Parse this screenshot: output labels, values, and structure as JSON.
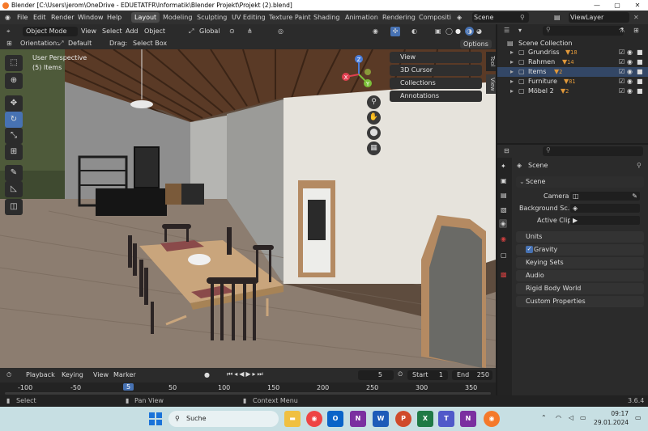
{
  "titlebar": {
    "title": "Blender [C:\\Users\\jerom\\OneDrive - EDUETATFR\\Informatik\\Blender Projekt\\Projekt (2).blend]"
  },
  "menu": {
    "file": "File",
    "edit": "Edit",
    "render": "Render",
    "window": "Window",
    "help": "Help"
  },
  "workspaces": [
    "Layout",
    "Modeling",
    "Sculpting",
    "UV Editing",
    "Texture Paint",
    "Shading",
    "Animation",
    "Rendering",
    "Compositi"
  ],
  "scene_name": "Scene",
  "view_layer": "ViewLayer",
  "header": {
    "mode": "Object Mode",
    "view": "View",
    "select": "Select",
    "add": "Add",
    "object": "Object",
    "transform": "Global"
  },
  "subheader": {
    "orientation_label": "Orientation:",
    "orientation_value": "Default",
    "drag_label": "Drag:",
    "drag_value": "Select Box",
    "options": "Options"
  },
  "viewport": {
    "perspective": "User Perspective",
    "selection": "(5) Items"
  },
  "npanel": [
    "View",
    "3D Cursor",
    "Collections",
    "Annotations"
  ],
  "vtabs": {
    "tool": "Tool",
    "view": "View"
  },
  "gizmo": {
    "x": "X",
    "y": "Y",
    "z": "Z"
  },
  "timeline": {
    "playback": "Playback",
    "keying": "Keying",
    "view": "View",
    "marker": "Marker",
    "current_frame": "5",
    "start_label": "Start",
    "start": "1",
    "end_label": "End",
    "end": "250",
    "ruler": [
      "-100",
      "-50",
      "5",
      "50",
      "100",
      "150",
      "200",
      "250",
      "300",
      "350"
    ]
  },
  "status": {
    "select": "Select",
    "pan": "Pan View",
    "context": "Context Menu",
    "version": "3.6.4"
  },
  "outliner": {
    "root": "Scene Collection",
    "items": [
      {
        "name": "Grundriss",
        "count": "18"
      },
      {
        "name": "Rahmen",
        "count": "14"
      },
      {
        "name": "Items",
        "count": "2"
      },
      {
        "name": "Furniture",
        "count": "81"
      },
      {
        "name": "Möbel 2",
        "count": "2"
      }
    ]
  },
  "properties": {
    "header": "Scene",
    "section": "Scene",
    "camera_label": "Camera",
    "bg_label": "Background Sc...",
    "clip_label": "Active Clip",
    "sections": [
      "Units",
      "Gravity",
      "Keying Sets",
      "Audio",
      "Rigid Body World",
      "Custom Properties"
    ]
  },
  "taskbar": {
    "search": "Suche",
    "time": "09:17",
    "date": "29.01.2024"
  },
  "colors": {
    "accent": "#4772b3",
    "gizmo_x": "#e04050",
    "gizmo_y": "#7cc03a",
    "gizmo_z": "#4a7cd8"
  }
}
